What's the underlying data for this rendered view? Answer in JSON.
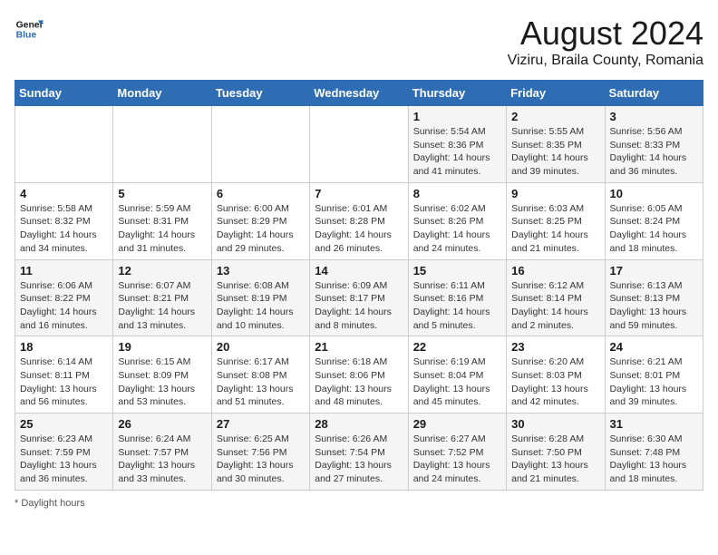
{
  "header": {
    "logo_general": "General",
    "logo_blue": "Blue",
    "month_year": "August 2024",
    "location": "Viziru, Braila County, Romania"
  },
  "days_of_week": [
    "Sunday",
    "Monday",
    "Tuesday",
    "Wednesday",
    "Thursday",
    "Friday",
    "Saturday"
  ],
  "weeks": [
    [
      {
        "day": "",
        "info": ""
      },
      {
        "day": "",
        "info": ""
      },
      {
        "day": "",
        "info": ""
      },
      {
        "day": "",
        "info": ""
      },
      {
        "day": "1",
        "info": "Sunrise: 5:54 AM\nSunset: 8:36 PM\nDaylight: 14 hours and 41 minutes."
      },
      {
        "day": "2",
        "info": "Sunrise: 5:55 AM\nSunset: 8:35 PM\nDaylight: 14 hours and 39 minutes."
      },
      {
        "day": "3",
        "info": "Sunrise: 5:56 AM\nSunset: 8:33 PM\nDaylight: 14 hours and 36 minutes."
      }
    ],
    [
      {
        "day": "4",
        "info": "Sunrise: 5:58 AM\nSunset: 8:32 PM\nDaylight: 14 hours and 34 minutes."
      },
      {
        "day": "5",
        "info": "Sunrise: 5:59 AM\nSunset: 8:31 PM\nDaylight: 14 hours and 31 minutes."
      },
      {
        "day": "6",
        "info": "Sunrise: 6:00 AM\nSunset: 8:29 PM\nDaylight: 14 hours and 29 minutes."
      },
      {
        "day": "7",
        "info": "Sunrise: 6:01 AM\nSunset: 8:28 PM\nDaylight: 14 hours and 26 minutes."
      },
      {
        "day": "8",
        "info": "Sunrise: 6:02 AM\nSunset: 8:26 PM\nDaylight: 14 hours and 24 minutes."
      },
      {
        "day": "9",
        "info": "Sunrise: 6:03 AM\nSunset: 8:25 PM\nDaylight: 14 hours and 21 minutes."
      },
      {
        "day": "10",
        "info": "Sunrise: 6:05 AM\nSunset: 8:24 PM\nDaylight: 14 hours and 18 minutes."
      }
    ],
    [
      {
        "day": "11",
        "info": "Sunrise: 6:06 AM\nSunset: 8:22 PM\nDaylight: 14 hours and 16 minutes."
      },
      {
        "day": "12",
        "info": "Sunrise: 6:07 AM\nSunset: 8:21 PM\nDaylight: 14 hours and 13 minutes."
      },
      {
        "day": "13",
        "info": "Sunrise: 6:08 AM\nSunset: 8:19 PM\nDaylight: 14 hours and 10 minutes."
      },
      {
        "day": "14",
        "info": "Sunrise: 6:09 AM\nSunset: 8:17 PM\nDaylight: 14 hours and 8 minutes."
      },
      {
        "day": "15",
        "info": "Sunrise: 6:11 AM\nSunset: 8:16 PM\nDaylight: 14 hours and 5 minutes."
      },
      {
        "day": "16",
        "info": "Sunrise: 6:12 AM\nSunset: 8:14 PM\nDaylight: 14 hours and 2 minutes."
      },
      {
        "day": "17",
        "info": "Sunrise: 6:13 AM\nSunset: 8:13 PM\nDaylight: 13 hours and 59 minutes."
      }
    ],
    [
      {
        "day": "18",
        "info": "Sunrise: 6:14 AM\nSunset: 8:11 PM\nDaylight: 13 hours and 56 minutes."
      },
      {
        "day": "19",
        "info": "Sunrise: 6:15 AM\nSunset: 8:09 PM\nDaylight: 13 hours and 53 minutes."
      },
      {
        "day": "20",
        "info": "Sunrise: 6:17 AM\nSunset: 8:08 PM\nDaylight: 13 hours and 51 minutes."
      },
      {
        "day": "21",
        "info": "Sunrise: 6:18 AM\nSunset: 8:06 PM\nDaylight: 13 hours and 48 minutes."
      },
      {
        "day": "22",
        "info": "Sunrise: 6:19 AM\nSunset: 8:04 PM\nDaylight: 13 hours and 45 minutes."
      },
      {
        "day": "23",
        "info": "Sunrise: 6:20 AM\nSunset: 8:03 PM\nDaylight: 13 hours and 42 minutes."
      },
      {
        "day": "24",
        "info": "Sunrise: 6:21 AM\nSunset: 8:01 PM\nDaylight: 13 hours and 39 minutes."
      }
    ],
    [
      {
        "day": "25",
        "info": "Sunrise: 6:23 AM\nSunset: 7:59 PM\nDaylight: 13 hours and 36 minutes."
      },
      {
        "day": "26",
        "info": "Sunrise: 6:24 AM\nSunset: 7:57 PM\nDaylight: 13 hours and 33 minutes."
      },
      {
        "day": "27",
        "info": "Sunrise: 6:25 AM\nSunset: 7:56 PM\nDaylight: 13 hours and 30 minutes."
      },
      {
        "day": "28",
        "info": "Sunrise: 6:26 AM\nSunset: 7:54 PM\nDaylight: 13 hours and 27 minutes."
      },
      {
        "day": "29",
        "info": "Sunrise: 6:27 AM\nSunset: 7:52 PM\nDaylight: 13 hours and 24 minutes."
      },
      {
        "day": "30",
        "info": "Sunrise: 6:28 AM\nSunset: 7:50 PM\nDaylight: 13 hours and 21 minutes."
      },
      {
        "day": "31",
        "info": "Sunrise: 6:30 AM\nSunset: 7:48 PM\nDaylight: 13 hours and 18 minutes."
      }
    ]
  ],
  "footer": {
    "note": "Daylight hours"
  }
}
